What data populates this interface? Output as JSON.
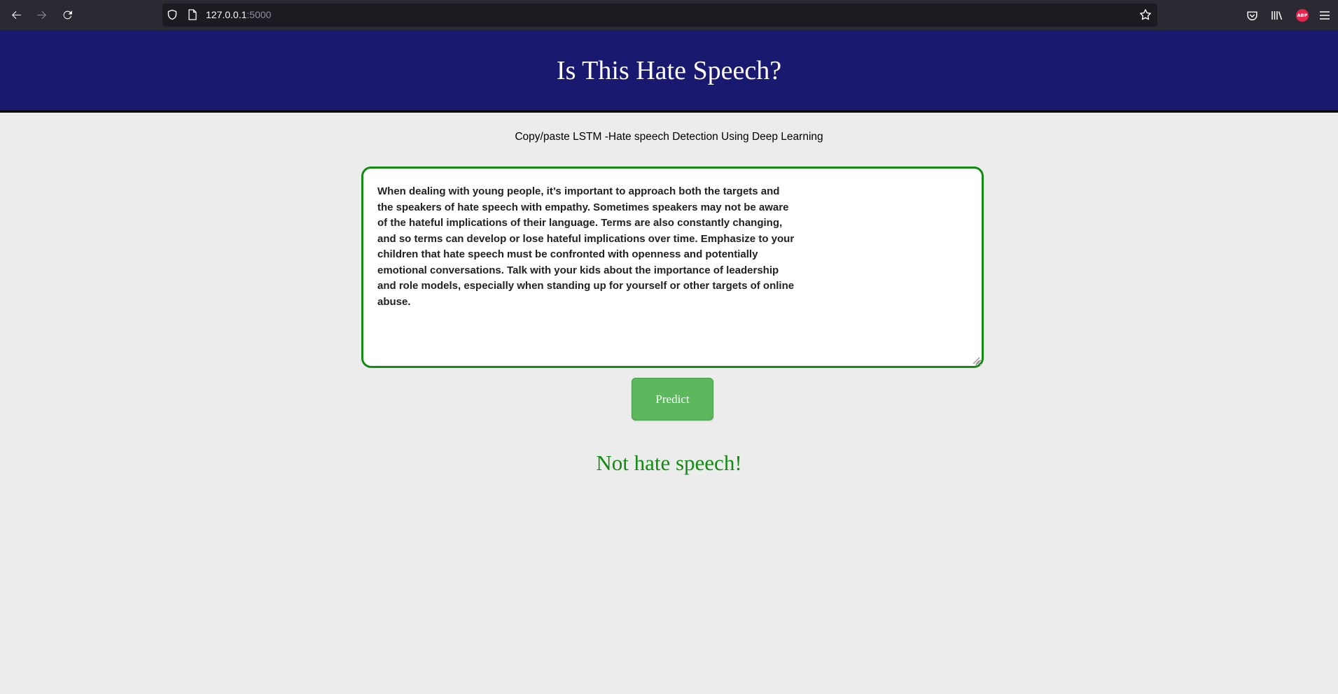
{
  "browser": {
    "url_host": "127.0.0.1",
    "url_port": ":5000",
    "abp_label": "ABP"
  },
  "page": {
    "title": "Is This Hate Speech?",
    "subtitle": "Copy/paste LSTM -Hate speech Detection Using Deep Learning",
    "input_text": "When dealing with young people, it’s important to approach both the targets and the speakers of hate speech with empathy. Sometimes speakers may not be aware of the hateful implications of their language. Terms are also constantly changing, and so terms can develop or lose hateful implications over time. Emphasize to your children that hate speech must be confronted with openness and potentially emotional conversations. Talk with your kids about the importance of leadership and role models, especially when standing up for yourself or other targets of online abuse.",
    "predict_label": "Predict",
    "result_text": "Not hate speech!"
  },
  "colors": {
    "header_bg": "#191970",
    "result": "#138a13",
    "button": "#5cb85c",
    "input_border": "#138a13"
  }
}
